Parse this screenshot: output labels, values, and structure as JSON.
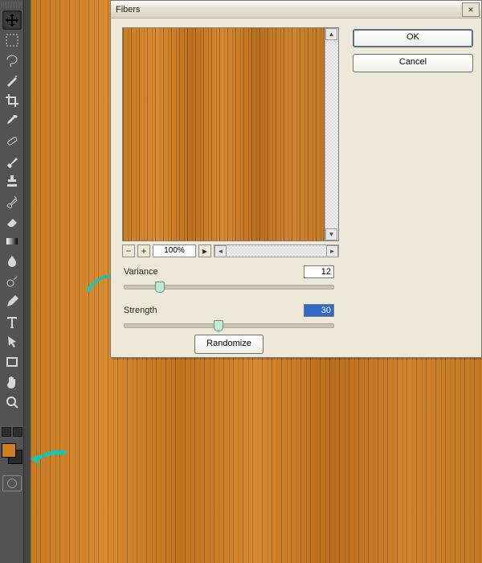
{
  "dialog": {
    "title": "Fibers",
    "ok": "OK",
    "cancel": "Cancel",
    "zoom": "100%",
    "variance_label": "Variance",
    "variance_value": "12",
    "variance_pos_pct": 17,
    "strength_label": "Strength",
    "strength_value": "30",
    "strength_pos_pct": 45,
    "randomize": "Randomize",
    "close_glyph": "×",
    "minus": "−",
    "plus": "+",
    "scroll_left": "◂",
    "scroll_right": "▸",
    "scroll_up": "▴",
    "scroll_down": "▾"
  },
  "swatch": {
    "foreground": "#cf7f1c"
  },
  "tools": [
    {
      "name": "move-tool",
      "icon": "move",
      "selected": true
    },
    {
      "name": "marquee-tool",
      "icon": "marquee"
    },
    {
      "name": "lasso-tool",
      "icon": "lasso"
    },
    {
      "name": "quick-select-tool",
      "icon": "wand"
    },
    {
      "name": "crop-tool",
      "icon": "crop"
    },
    {
      "name": "eyedropper-tool",
      "icon": "eyedrop"
    },
    {
      "name": "healing-tool",
      "icon": "bandaid"
    },
    {
      "name": "brush-tool",
      "icon": "brush"
    },
    {
      "name": "stamp-tool",
      "icon": "stamp"
    },
    {
      "name": "history-brush-tool",
      "icon": "histbrush"
    },
    {
      "name": "eraser-tool",
      "icon": "eraser"
    },
    {
      "name": "gradient-tool",
      "icon": "gradient"
    },
    {
      "name": "blur-tool",
      "icon": "drop"
    },
    {
      "name": "dodge-tool",
      "icon": "dodge"
    },
    {
      "name": "pen-tool",
      "icon": "pen"
    },
    {
      "name": "type-tool",
      "icon": "type"
    },
    {
      "name": "path-select-tool",
      "icon": "arrow"
    },
    {
      "name": "shape-tool",
      "icon": "rect"
    },
    {
      "name": "hand-tool",
      "icon": "hand"
    },
    {
      "name": "zoom-tool",
      "icon": "zoom"
    }
  ]
}
